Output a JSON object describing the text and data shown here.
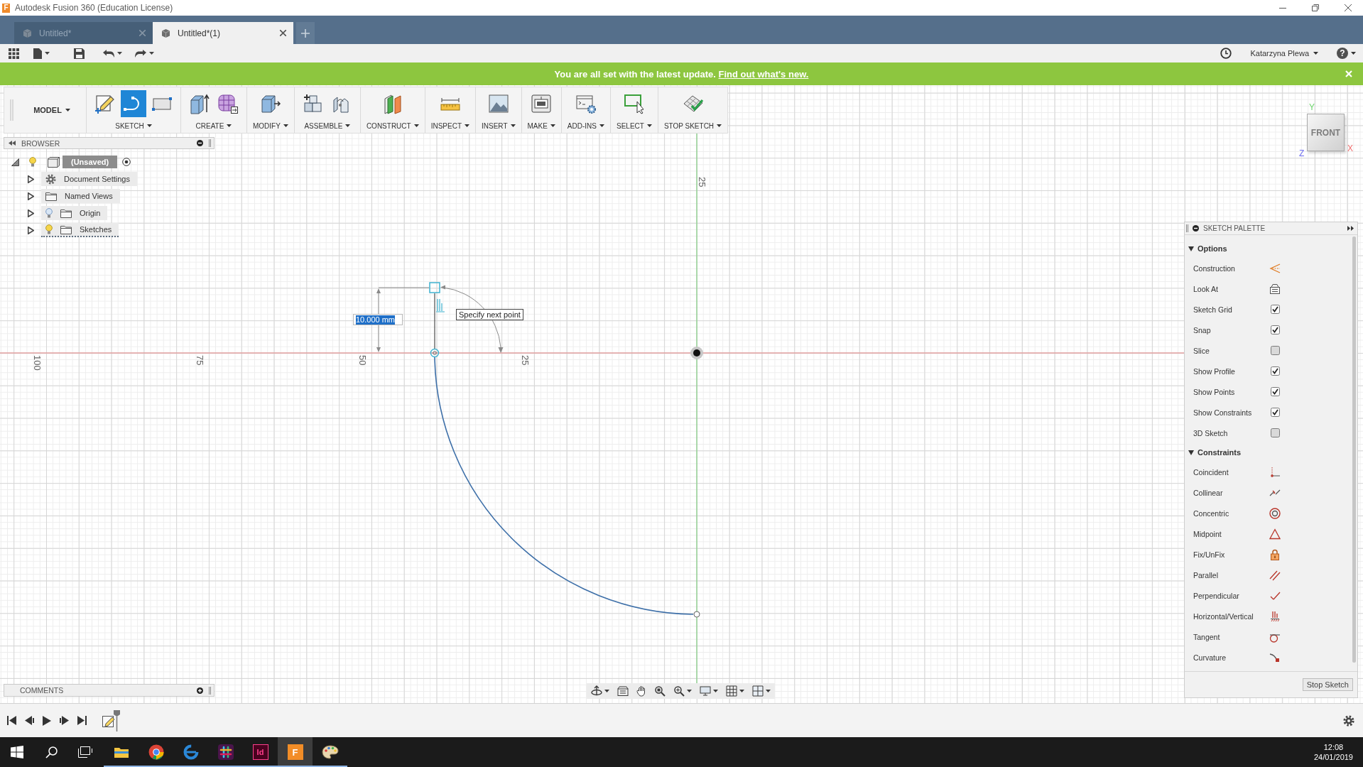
{
  "window": {
    "icon_glyph": "F",
    "title": "Autodesk Fusion 360 (Education License)"
  },
  "tabs": [
    {
      "label": "Untitled*",
      "selected": false
    },
    {
      "label": "Untitled*(1)",
      "selected": true
    }
  ],
  "quick_access": {
    "user": "Katarzyna Plewa",
    "help": "?"
  },
  "banner": {
    "text": "You are all set with the latest update.",
    "link": "Find out what's new."
  },
  "toolbar": {
    "workspace": "MODEL",
    "groups": [
      {
        "label": "SKETCH",
        "tools": [
          {
            "kind": "create-sketch",
            "selected": false
          },
          {
            "kind": "arc",
            "selected": true
          },
          {
            "kind": "rectangle",
            "selected": false
          }
        ]
      },
      {
        "label": "CREATE",
        "tools": [
          {
            "kind": "extrude",
            "selected": false
          },
          {
            "kind": "form",
            "selected": false
          }
        ]
      },
      {
        "label": "MODIFY",
        "tools": [
          {
            "kind": "press-pull",
            "selected": false
          }
        ]
      },
      {
        "label": "ASSEMBLE",
        "tools": [
          {
            "kind": "new-component",
            "selected": false
          },
          {
            "kind": "joint",
            "selected": false
          }
        ]
      },
      {
        "label": "CONSTRUCT",
        "tools": [
          {
            "kind": "plane",
            "selected": false
          }
        ]
      },
      {
        "label": "INSPECT",
        "tools": [
          {
            "kind": "measure",
            "selected": false
          }
        ]
      },
      {
        "label": "INSERT",
        "tools": [
          {
            "kind": "image",
            "selected": false
          }
        ]
      },
      {
        "label": "MAKE",
        "tools": [
          {
            "kind": "print",
            "selected": false
          }
        ]
      },
      {
        "label": "ADD-INS",
        "tools": [
          {
            "kind": "scripts",
            "selected": false
          }
        ]
      },
      {
        "label": "SELECT",
        "tools": [
          {
            "kind": "select",
            "selected": false
          }
        ]
      },
      {
        "label": "STOP SKETCH",
        "tools": [
          {
            "kind": "finish-sketch",
            "selected": false
          }
        ]
      }
    ]
  },
  "browser": {
    "title": "BROWSER",
    "root": {
      "label": "(Unsaved)",
      "expanded": true,
      "visible": true,
      "children": [
        {
          "label": "Document Settings",
          "kind": "settings",
          "expanded": false,
          "active": false
        },
        {
          "label": "Named Views",
          "kind": "folder",
          "expanded": false,
          "active": false
        },
        {
          "label": "Origin",
          "kind": "folder",
          "expanded": false,
          "visible": false,
          "active": false
        },
        {
          "label": "Sketches",
          "kind": "folder",
          "expanded": false,
          "visible": true,
          "active": true
        }
      ]
    }
  },
  "canvas": {
    "x_labels": [
      "100",
      "75",
      "50",
      "25"
    ],
    "y_labels": [
      "25"
    ],
    "dimension_value": "10.000 mm",
    "prompt": "Specify next point"
  },
  "view_cube": {
    "face": "FRONT",
    "axes": {
      "y": "Y",
      "x": "X",
      "z": "Z"
    }
  },
  "sketch_palette": {
    "title": "SKETCH PALETTE",
    "sections": [
      {
        "title": "Options",
        "expanded": true,
        "rows": [
          {
            "label": "Construction",
            "kind": "construction"
          },
          {
            "label": "Look At",
            "kind": "look-at"
          },
          {
            "label": "Sketch Grid",
            "kind": "checkbox",
            "checked": true
          },
          {
            "label": "Snap",
            "kind": "checkbox",
            "checked": true
          },
          {
            "label": "Slice",
            "kind": "checkbox",
            "checked": false
          },
          {
            "label": "Show Profile",
            "kind": "checkbox",
            "checked": true
          },
          {
            "label": "Show Points",
            "kind": "checkbox",
            "checked": true
          },
          {
            "label": "Show Constraints",
            "kind": "checkbox",
            "checked": true
          },
          {
            "label": "3D Sketch",
            "kind": "checkbox",
            "checked": false
          }
        ]
      },
      {
        "title": "Constraints",
        "expanded": true,
        "rows": [
          {
            "label": "Coincident",
            "kind": "coincident"
          },
          {
            "label": "Collinear",
            "kind": "collinear"
          },
          {
            "label": "Concentric",
            "kind": "concentric"
          },
          {
            "label": "Midpoint",
            "kind": "midpoint"
          },
          {
            "label": "Fix/UnFix",
            "kind": "fix"
          },
          {
            "label": "Parallel",
            "kind": "parallel"
          },
          {
            "label": "Perpendicular",
            "kind": "perpendicular"
          },
          {
            "label": "Horizontal/Vertical",
            "kind": "horizontal-vertical"
          },
          {
            "label": "Tangent",
            "kind": "tangent"
          },
          {
            "label": "Curvature",
            "kind": "curvature"
          }
        ]
      }
    ],
    "button": "Stop Sketch"
  },
  "comments": {
    "title": "COMMENTS"
  },
  "taskbar": {
    "apps": [
      {
        "kind": "folder",
        "running": true,
        "selected": false
      },
      {
        "kind": "ring",
        "running": true,
        "selected": false
      },
      {
        "kind": "e-logo",
        "running": true,
        "selected": false
      },
      {
        "kind": "hash-logo",
        "running": true,
        "selected": false
      },
      {
        "kind": "id-tile",
        "glyph": "Id",
        "running": true,
        "selected": false
      },
      {
        "kind": "f-tile",
        "glyph": "F",
        "running": true,
        "selected": true
      },
      {
        "kind": "palette",
        "running": true,
        "selected": false
      }
    ],
    "time": "12:08",
    "date": "24/01/2019"
  }
}
